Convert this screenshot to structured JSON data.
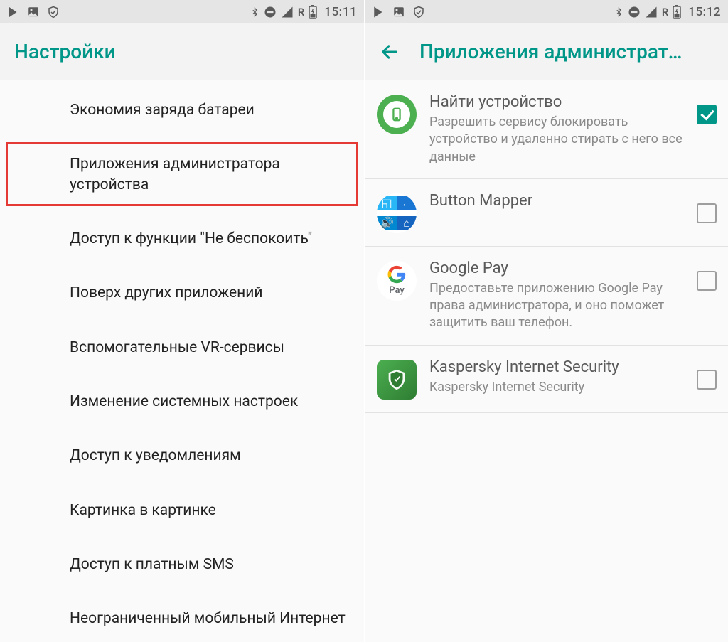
{
  "status": {
    "roaming": "R",
    "time_left": "15:11",
    "time_right": "15:12"
  },
  "left": {
    "title": "Настройки",
    "items": [
      "Экономия заряда батареи",
      "Приложения администратора устройства",
      "Доступ к функции \"Не беспокоить\"",
      "Поверх других приложений",
      "Вспомогательные VR-сервисы",
      "Изменение системных настроек",
      "Доступ к уведомлениям",
      "Картинка в картинке",
      "Доступ к платным SMS",
      "Неограниченный мобильный Интернет"
    ],
    "highlighted_index": 1
  },
  "right": {
    "title": "Приложения администрат…",
    "apps": [
      {
        "name": "Найти устройство",
        "desc": "Разрешить сервису блокировать устройство и удаленно стирать с него все данные",
        "checked": true,
        "icon": "find-device"
      },
      {
        "name": "Button Mapper",
        "desc": "",
        "checked": false,
        "icon": "button-mapper"
      },
      {
        "name": "Google Pay",
        "desc": "Предоставьте приложению Google Pay права администратора, и оно поможет защитить ваш телефон.",
        "checked": false,
        "icon": "google-pay"
      },
      {
        "name": "Kaspersky Internet Security",
        "desc": "Kaspersky Internet Security",
        "checked": false,
        "icon": "kaspersky"
      }
    ]
  },
  "gpay_label": "Pay"
}
